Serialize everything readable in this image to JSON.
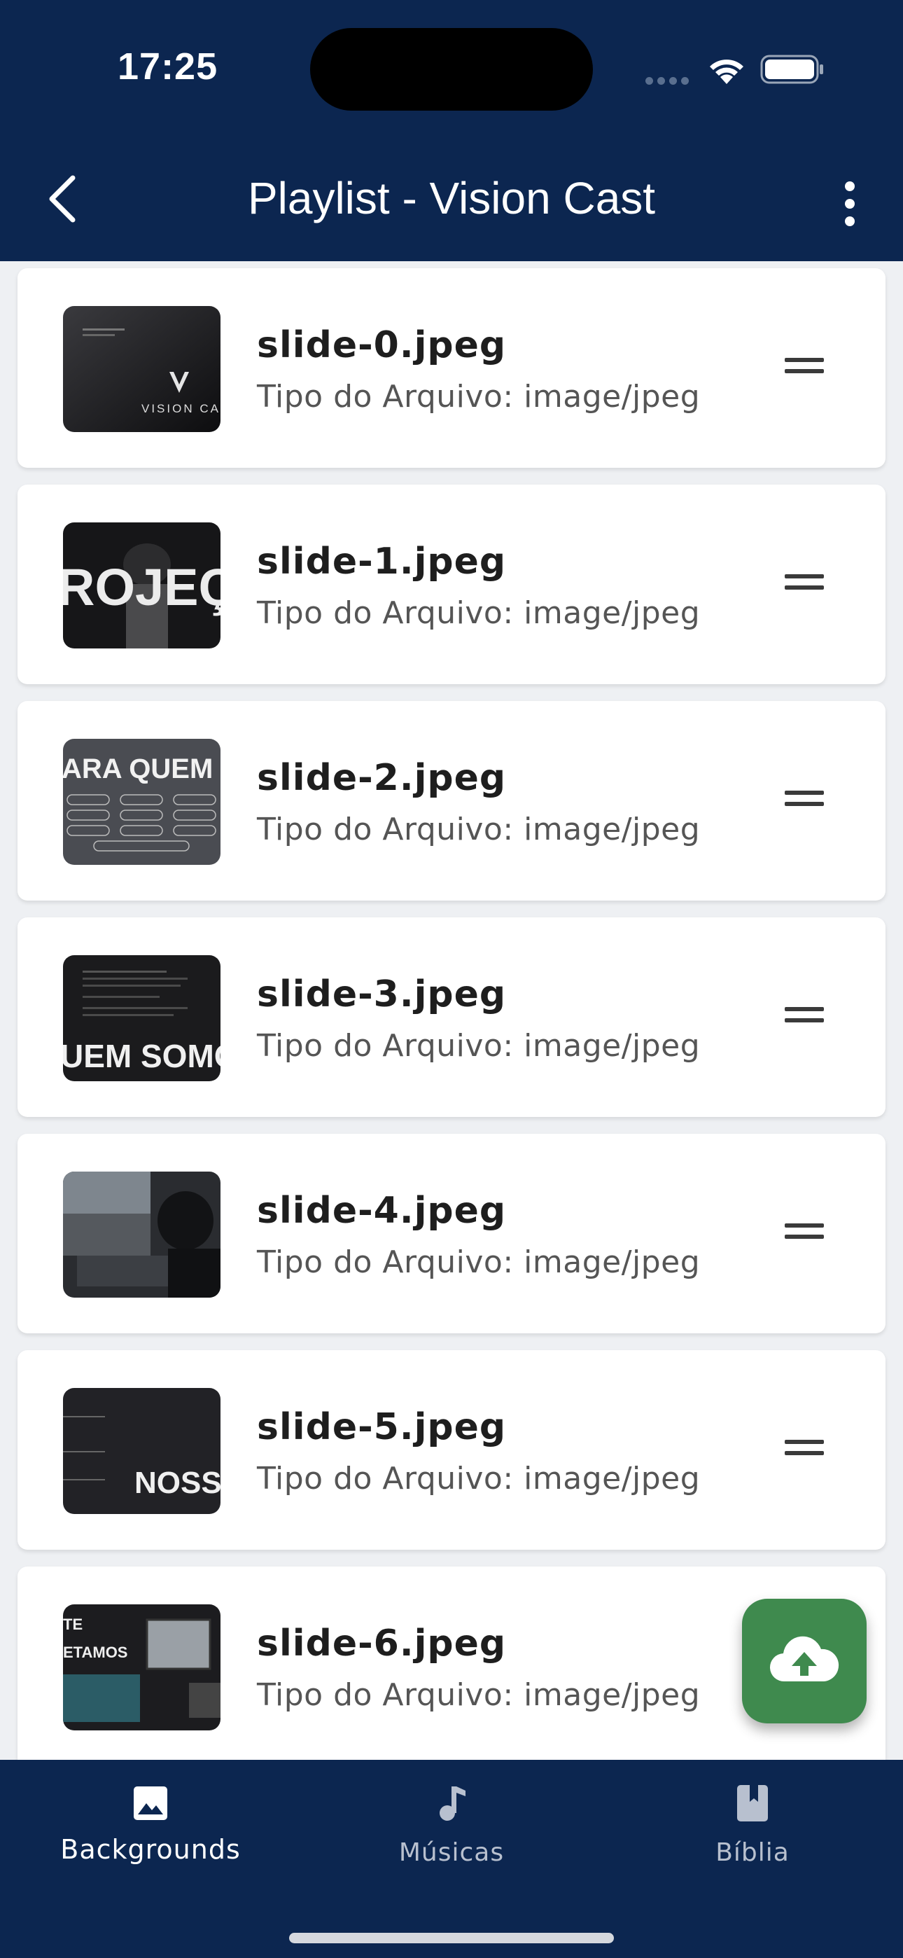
{
  "status": {
    "time": "17:25"
  },
  "appbar": {
    "title": "Playlist - Vision Cast"
  },
  "files": [
    {
      "name": "slide-0.jpeg",
      "type": "Tipo do Arquivo: image/jpeg",
      "thumb_text": "VISION CAS"
    },
    {
      "name": "slide-1.jpeg",
      "type": "Tipo do Arquivo: image/jpeg",
      "thumb_text": "ROJEÇÃ"
    },
    {
      "name": "slide-2.jpeg",
      "type": "Tipo do Arquivo: image/jpeg",
      "thumb_text": "ARA QUEM SERVE"
    },
    {
      "name": "slide-3.jpeg",
      "type": "Tipo do Arquivo: image/jpeg",
      "thumb_text": "UEM SOMOS"
    },
    {
      "name": "slide-4.jpeg",
      "type": "Tipo do Arquivo: image/jpeg",
      "thumb_text": ""
    },
    {
      "name": "slide-5.jpeg",
      "type": "Tipo do Arquivo: image/jpeg",
      "thumb_text": "NOSSO DI"
    },
    {
      "name": "slide-6.jpeg",
      "type": "Tipo do Arquivo: image/jpeg",
      "thumb_text": "TE ETAMOS"
    }
  ],
  "nav": {
    "backgrounds": "Backgrounds",
    "musicas": "Músicas",
    "biblia": "Bíblia"
  },
  "colors": {
    "header": "#0c2650",
    "nav_active": "#ffffff",
    "nav_inactive": "#8e9bb3",
    "fab": "#3f8a4e"
  },
  "icons": {
    "back": "chevron-left-icon",
    "more": "more-vertical-icon",
    "drag": "drag-handle-icon",
    "fab": "cloud-upload-icon",
    "backgrounds": "image-icon",
    "musicas": "music-note-icon",
    "biblia": "book-icon"
  }
}
